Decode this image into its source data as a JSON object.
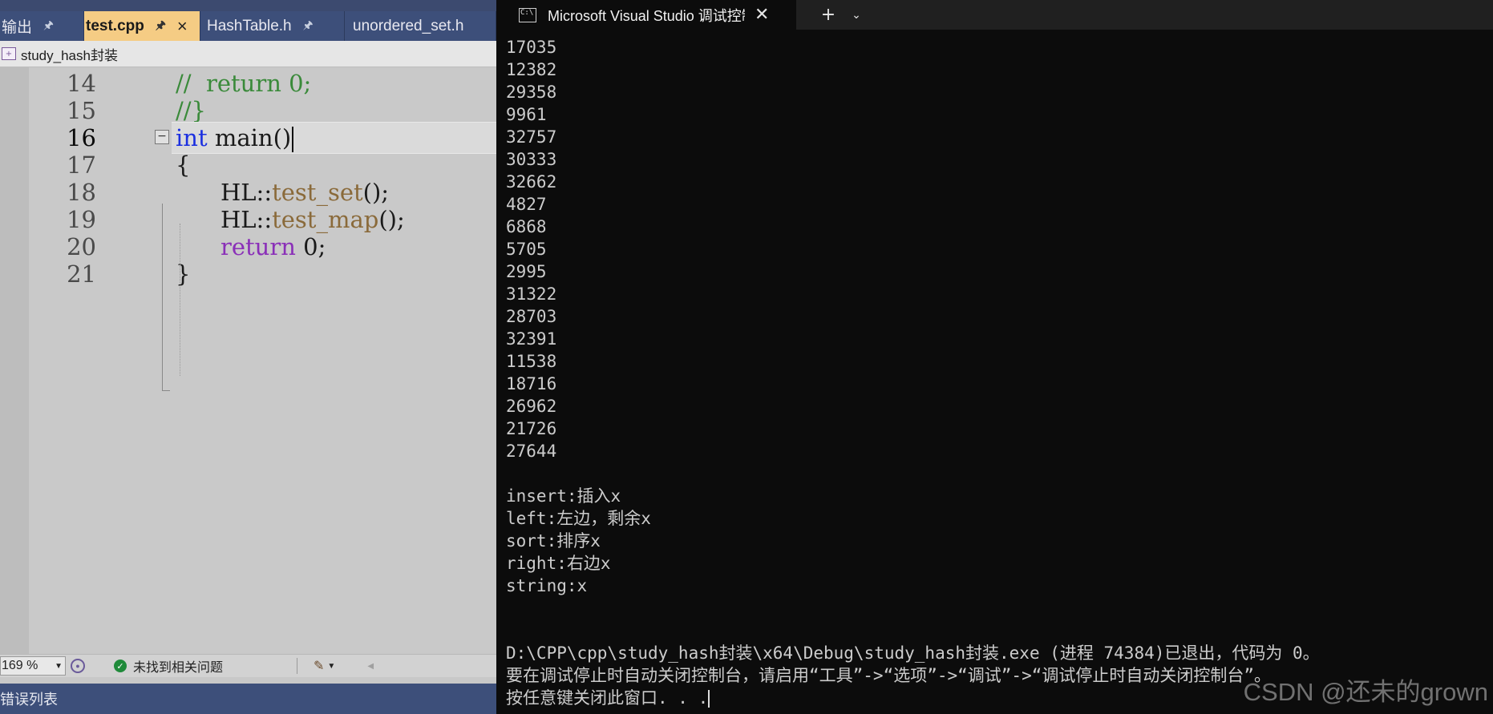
{
  "vs": {
    "tabs": {
      "output": "输出",
      "test": "test.cpp",
      "hashtable": "HashTable.h",
      "unordered": "unordered_set.h",
      "pin_icon": "pin-icon",
      "close_icon": "close-icon"
    },
    "nav": {
      "project": "study_hash封装"
    },
    "editor": {
      "line_numbers": [
        "14",
        "15",
        "16",
        "17",
        "18",
        "19",
        "20",
        "21"
      ],
      "current_line": "16",
      "code": {
        "l14_comment": "//  return 0;",
        "l15_comment": "//}",
        "l16_kw": "int",
        "l16_rest": " main()",
        "l17_brace": "{",
        "l18_ns": "HL::",
        "l18_fn": "test_set",
        "l18_tail": "();",
        "l19_ns": "HL::",
        "l19_fn": "test_map",
        "l19_tail": "();",
        "l20_kw": "return",
        "l20_tail": " 0;",
        "l21_brace": "}"
      },
      "fold_symbol": "−"
    },
    "status": {
      "zoom": "169 %",
      "issues": "未找到相关问题"
    },
    "errorlist": {
      "label": "错误列表"
    }
  },
  "terminal": {
    "tab_title": "Microsoft Visual Studio 调试控制台",
    "close_glyph": "✕",
    "new_tab_glyph": "+",
    "dropdown_glyph": "⌄",
    "numbers": [
      "17035",
      "12382",
      "29358",
      "9961",
      "32757",
      "30333",
      "32662",
      "4827",
      "6868",
      "5705",
      "2995",
      "31322",
      "28703",
      "32391",
      "11538",
      "18716",
      "26962",
      "21726",
      "27644"
    ],
    "map_lines": [
      "insert:插入x",
      "left:左边，剩余x",
      "sort:排序x",
      "right:右边x",
      "string:x"
    ],
    "exit_line": "D:\\CPP\\cpp\\study_hash封装\\x64\\Debug\\study_hash封装.exe (进程 74384)已退出，代码为 0。",
    "hint_line": "要在调试停止时自动关闭控制台，请启用“工具”->“选项”->“调试”->“调试停止时自动关闭控制台”。",
    "press_key_line": "按任意键关闭此窗口. . ."
  },
  "watermark": "CSDN @还未的grown"
}
